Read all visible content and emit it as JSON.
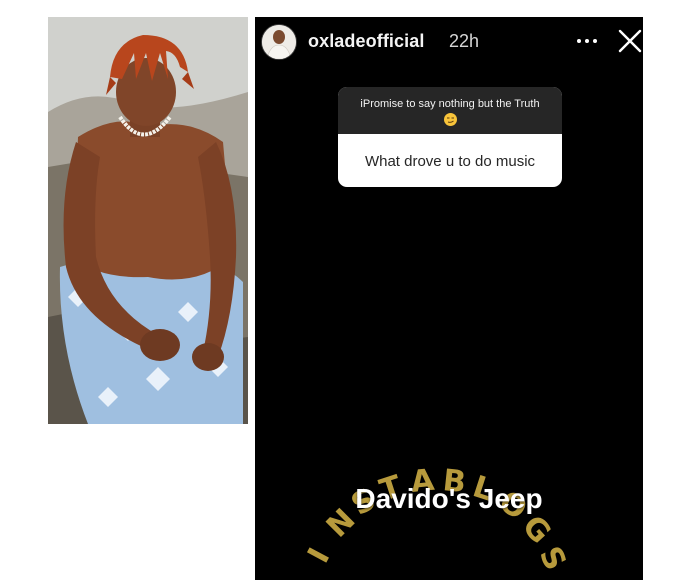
{
  "story": {
    "username": "oxladeofficial",
    "timestamp": "22h",
    "more_icon": "more-horizontal-icon",
    "close_icon": "close-x-icon"
  },
  "question_sticker": {
    "prompt": "iPromise to say nothing but the Truth",
    "emoji": "smirking-face-emoji",
    "answer": "What drove u to do music"
  },
  "caption": "Davido's Jeep",
  "watermark": "INSTABLOGS",
  "colors": {
    "story_background": "#000000",
    "sticker_header": "#262626",
    "watermark": "#b79a3c"
  }
}
